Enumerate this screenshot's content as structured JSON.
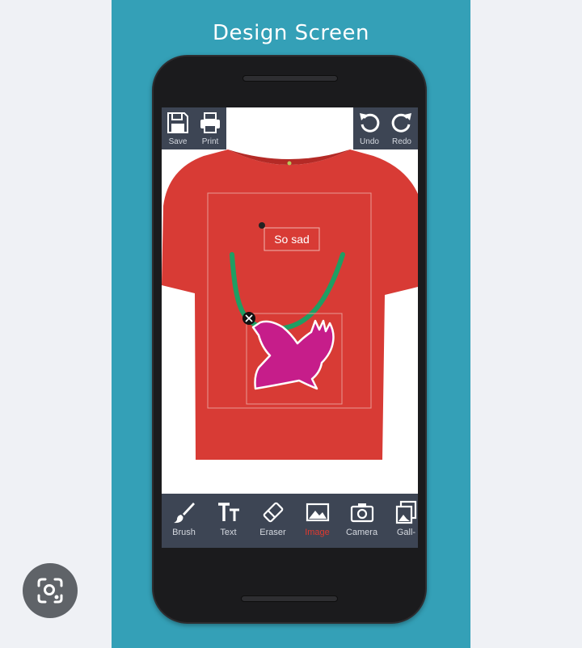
{
  "panel": {
    "title": "Design Screen"
  },
  "toolbar_top": {
    "save_label": "Save",
    "print_label": "Print",
    "undo_label": "Undo",
    "redo_label": "Redo"
  },
  "canvas": {
    "text_sticker": "So sad"
  },
  "toolbar_bottom": {
    "brush_label": "Brush",
    "text_label": "Text",
    "eraser_label": "Eraser",
    "image_label": "Image",
    "camera_label": "Camera",
    "gallery_label": "Gall-"
  },
  "colors": {
    "panel_bg": "#34a0b7",
    "toolbar_bg": "#3d4554",
    "shirt": "#d83b35",
    "brush_stroke": "#1f9e63",
    "bird": "#c61d8a",
    "active_label": "#e0392f"
  }
}
